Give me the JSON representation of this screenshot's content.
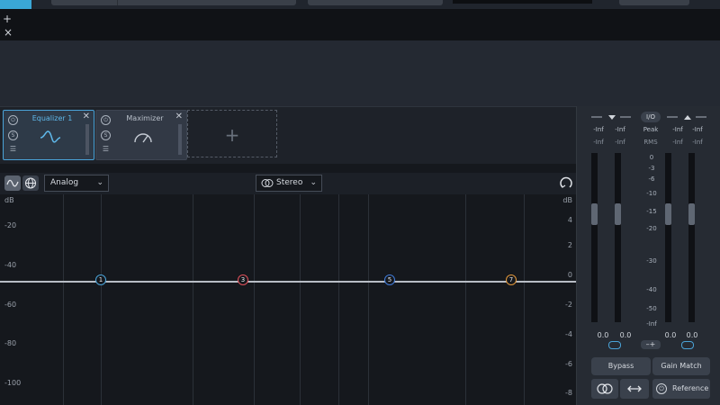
{
  "top": {
    "add_glyph": "+",
    "close_glyph": "×"
  },
  "rack": {
    "devices": [
      {
        "name": "Equalizer 1",
        "icon": "eq-curve-icon",
        "active": true
      },
      {
        "name": "Maximizer",
        "icon": "gauge-icon",
        "active": false
      }
    ],
    "add_glyph": "+"
  },
  "eq_toolbar": {
    "mode_select": "Analog",
    "channel_select": "Stereo"
  },
  "graph": {
    "left_unit": "dB",
    "left_labels": [
      "-20",
      "-40",
      "-60",
      "-80",
      "-100"
    ],
    "right_unit": "dB",
    "right_labels": [
      "4",
      "2",
      "0",
      "-2",
      "-4",
      "-6",
      "-8"
    ],
    "nodes": [
      {
        "label": "1",
        "color": "#4aa3d8"
      },
      {
        "label": "3",
        "color": "#e0505a"
      },
      {
        "label": "5",
        "color": "#3f7ad8"
      },
      {
        "label": "7",
        "color": "#e0963a"
      }
    ]
  },
  "meters": {
    "io_label": "I/O",
    "peak_label": "Peak",
    "rms_label": "RMS",
    "peak_values": [
      "-Inf",
      "-Inf",
      "-Inf",
      "-Inf"
    ],
    "rms_values": [
      "-Inf",
      "-Inf",
      "-Inf",
      "-Inf"
    ],
    "scale": [
      "0",
      "-3",
      "-6",
      "-10",
      "-15",
      "-20",
      "-30",
      "-40",
      "-50",
      "-Inf"
    ],
    "fader_values": [
      "0.0",
      "0.0",
      "0.0",
      "0.0"
    ],
    "bypass_label": "Bypass",
    "gain_match_label": "Gain Match",
    "reference_label": "Reference",
    "accent": "#4aa3d8"
  }
}
